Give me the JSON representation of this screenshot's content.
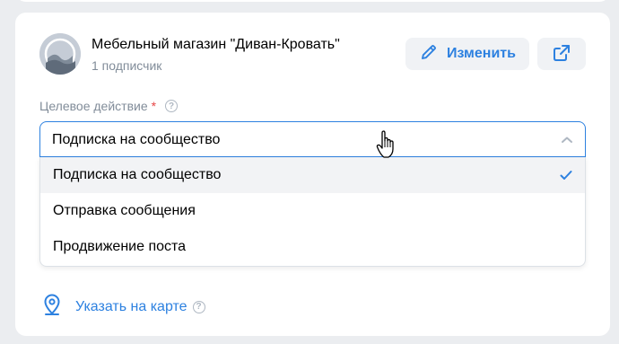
{
  "community": {
    "name": "Мебельный магазин \"Диван-Кровать\"",
    "subscribers": "1 подписчик"
  },
  "actions": {
    "edit_label": "Изменить",
    "edit_icon": "pencil-icon",
    "open_icon": "external-link-icon"
  },
  "target_action": {
    "label": "Целевое действие",
    "required_mark": "*",
    "help_glyph": "?",
    "selected": "Подписка на сообщество",
    "options": [
      {
        "label": "Подписка на сообщество",
        "selected": true
      },
      {
        "label": "Отправка сообщения",
        "selected": false
      },
      {
        "label": "Продвижение поста",
        "selected": false
      }
    ]
  },
  "map": {
    "label": "Указать на карте",
    "help_glyph": "?",
    "icon": "map-pin-icon"
  },
  "colors": {
    "accent": "#2d81e0",
    "background": "#ebedf0",
    "secondary_text": "#818c99",
    "required": "#e64646"
  }
}
